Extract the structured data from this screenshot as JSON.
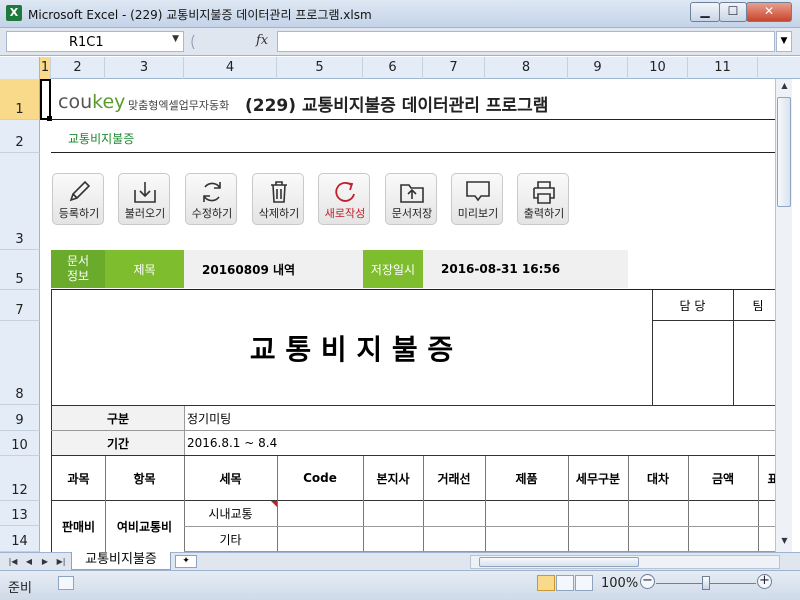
{
  "window": {
    "title": "Microsoft Excel - (229) 교통비지불증 데이터관리 프로그램.xlsm",
    "app_icon": "X",
    "min_icon": "minimize-icon",
    "max_icon": "maximize-icon",
    "close_icon": "close-icon"
  },
  "formula_bar": {
    "name_box": "R1C1",
    "fx_label": "fx",
    "formula": ""
  },
  "columns": [
    "1",
    "2",
    "3",
    "4",
    "5",
    "6",
    "7",
    "8",
    "9",
    "10",
    "11"
  ],
  "rows": [
    "1",
    "2",
    "3",
    "5",
    "7",
    "8",
    "9",
    "10",
    "12",
    "13",
    "14"
  ],
  "sheet": {
    "logo_main": "cou",
    "logo_accent": "key",
    "logo_sub": "맞춤형엑셀업무자동화",
    "app_title": "(229) 교통비지불증 데이터관리 프로그램",
    "subtitle": "교통비지불증",
    "toolbar": [
      {
        "label": "등록하기",
        "icon": "pencil-icon"
      },
      {
        "label": "불러오기",
        "icon": "download-tray-icon"
      },
      {
        "label": "수정하기",
        "icon": "refresh-icon"
      },
      {
        "label": "삭제하기",
        "icon": "trash-icon"
      },
      {
        "label": "새로작성",
        "icon": "new-document-icon"
      },
      {
        "label": "문서저장",
        "icon": "folder-upload-icon"
      },
      {
        "label": "미리보기",
        "icon": "monitor-icon"
      },
      {
        "label": "출력하기",
        "icon": "printer-icon"
      }
    ],
    "docinfo": {
      "label": "문서\n정보",
      "title_label": "제목",
      "title_value": "20160809 내역",
      "saved_label": "저장일시",
      "saved_value": "2016-08-31 16:56"
    },
    "form": {
      "heading": "교 통 비 지 불 증",
      "approval_1": "담 당",
      "approval_2": "팀",
      "category_label": "구분",
      "category_value": "정기미팅",
      "period_label": "기간",
      "period_value": "2016.8.1 ~ 8.4"
    },
    "table": {
      "headers": [
        "과목",
        "항목",
        "세목",
        "Code",
        "본지사",
        "거래선",
        "제품",
        "세무구분",
        "대차",
        "금액",
        "표"
      ],
      "rows": [
        {
          "subject": "판매비",
          "item": "여비교통비",
          "detail": "시내교통"
        },
        {
          "subject": "",
          "item": "",
          "detail": "기타"
        }
      ]
    }
  },
  "tabs": {
    "active": "교통비지불증"
  },
  "status": {
    "text": "준비",
    "zoom": "100%",
    "zoom_minus": "−",
    "zoom_plus": "+"
  }
}
